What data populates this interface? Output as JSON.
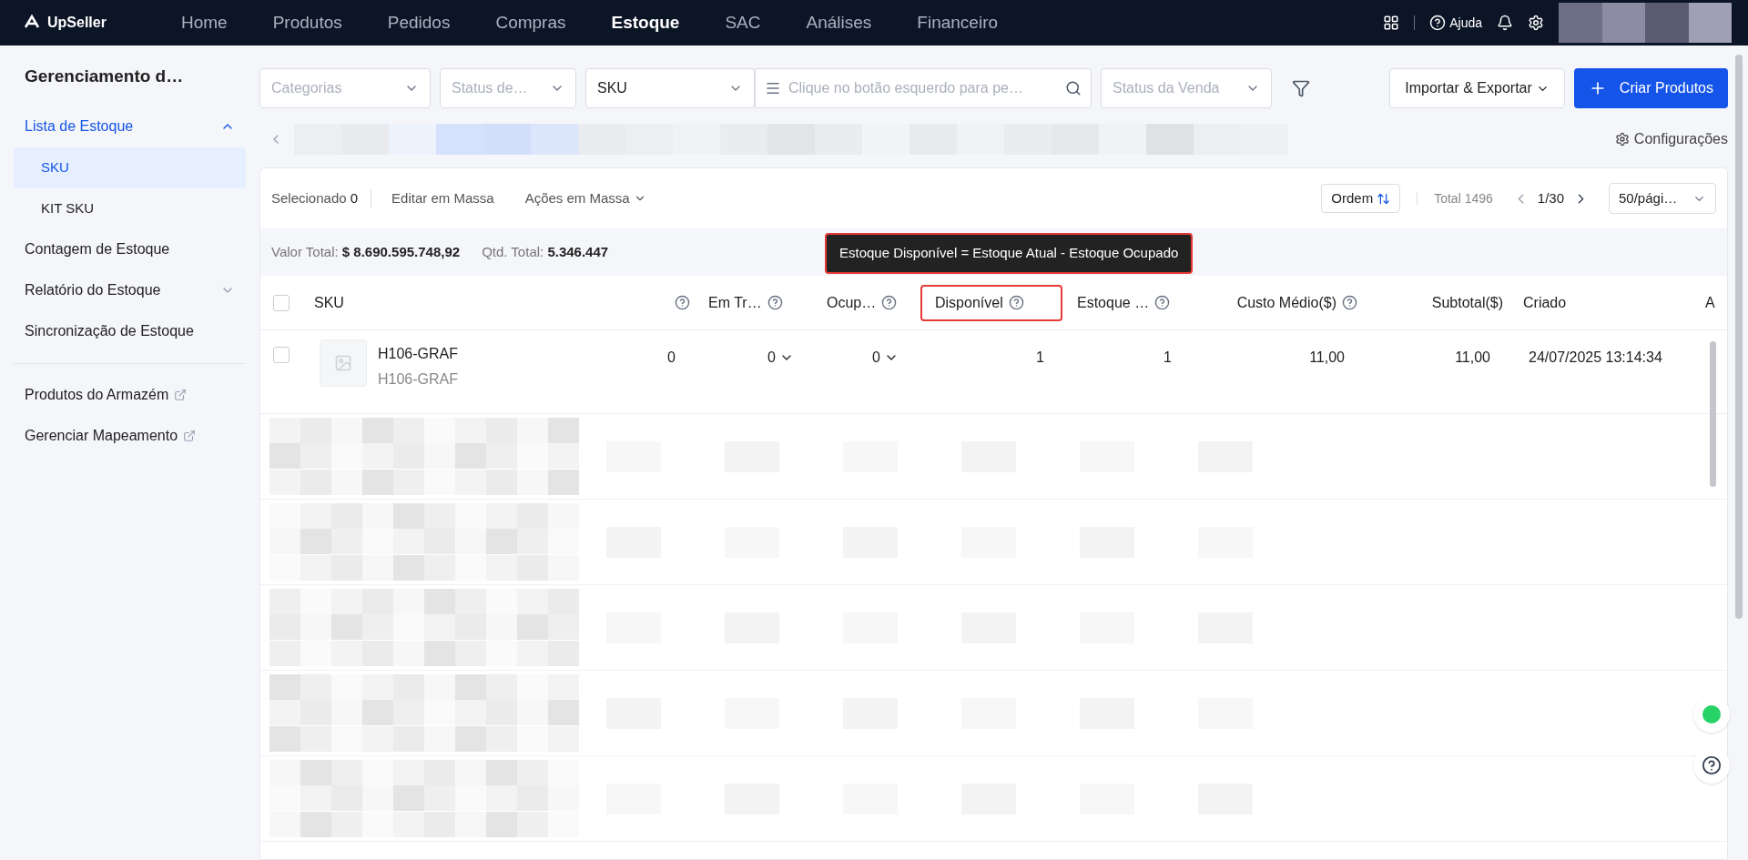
{
  "top_nav": {
    "logo": "UpSeller",
    "help": "Ajuda",
    "items": [
      {
        "label": "Home",
        "selected": false
      },
      {
        "label": "Produtos",
        "selected": false
      },
      {
        "label": "Pedidos",
        "selected": false
      },
      {
        "label": "Compras",
        "selected": false
      },
      {
        "label": "Estoque",
        "selected": true
      },
      {
        "label": "SAC",
        "selected": false
      },
      {
        "label": "Análises",
        "selected": false
      },
      {
        "label": "Financeiro",
        "selected": false
      }
    ]
  },
  "sidebar": {
    "title": "Gerenciamento d…",
    "items": [
      {
        "label": "Lista de Estoque",
        "kind": "group",
        "expanded": true,
        "selected": true,
        "children": [
          {
            "label": "SKU",
            "selected": true
          },
          {
            "label": "KIT SKU",
            "selected": false
          }
        ]
      },
      {
        "label": "Contagem de Estoque",
        "kind": "link",
        "selected": false
      },
      {
        "label": "Relatório do Estoque",
        "kind": "group",
        "expanded": false,
        "selected": false
      },
      {
        "label": "Sincronização de Estoque",
        "kind": "link",
        "selected": false
      }
    ],
    "external_links": [
      "Produtos do Armazém",
      "Gerenciar Mapeamento"
    ]
  },
  "filters": [
    {
      "kind": "select",
      "placeholder": "Categorias"
    },
    {
      "kind": "select",
      "placeholder": "Status de…"
    },
    {
      "kind": "select",
      "value": "SKU"
    },
    {
      "kind": "search",
      "placeholder": "Clique no botão esquerdo para pe…"
    },
    {
      "kind": "select",
      "placeholder": "Status da Venda"
    }
  ],
  "import_export": "Importar & Exportar",
  "create_button": "Criar Produtos",
  "settings_link": "Configurações",
  "toolbar": {
    "selected_label": "Selecionado",
    "selected_count": "0",
    "bulk_edit": "Editar em Massa",
    "bulk_actions": "Ações em Massa",
    "order": "Ordem",
    "total": "Total 1496",
    "page": "1/30",
    "page_size": "50/pági…"
  },
  "summary": [
    {
      "label": "Valor Total:",
      "value": "$ 8.690.595.748,92"
    },
    {
      "label": "Qtd. Total:",
      "value": "5.346.447"
    }
  ],
  "tooltip": "Estoque Disponível = Estoque Atual - Estoque Ocupado",
  "table": {
    "columns": [
      {
        "kind": "check",
        "checked": false
      },
      {
        "kind": "text",
        "label": "SKU"
      },
      {
        "kind": "num",
        "help": true
      },
      {
        "kind": "num",
        "label": "Em Tr…",
        "help": true
      },
      {
        "kind": "num",
        "label": "Ocup…",
        "help": true
      },
      {
        "kind": "num",
        "label": "Disponível",
        "help": true,
        "highlighted": true
      },
      {
        "kind": "num",
        "label": "Estoque …",
        "help": true
      },
      {
        "kind": "num",
        "label": "Custo Médio($)",
        "help": true
      },
      {
        "kind": "num",
        "label": "Subtotal($)"
      },
      {
        "kind": "text",
        "label": "Criado"
      },
      {
        "kind": "text",
        "label": "A"
      }
    ],
    "rows": [
      {
        "cells": [
          {
            "kind": "check",
            "checked": false
          },
          {
            "kind": "sku",
            "text": "H106-GRAF",
            "subtext": "H106-GRAF"
          },
          {
            "kind": "num",
            "text": "0"
          },
          {
            "kind": "num",
            "text": "0",
            "dropdown": true
          },
          {
            "kind": "num",
            "text": "0",
            "dropdown": true
          },
          {
            "kind": "num",
            "text": "1"
          },
          {
            "kind": "num",
            "text": "1"
          },
          {
            "kind": "num",
            "text": "11,00"
          },
          {
            "kind": "num",
            "text": "11,00"
          },
          {
            "kind": "date",
            "text": "24/07/2025 13:14:34"
          }
        ]
      }
    ]
  }
}
